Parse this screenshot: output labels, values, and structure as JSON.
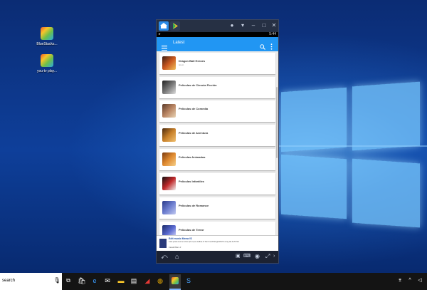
{
  "desktop": {
    "icons": [
      {
        "label": "BlueStacks..."
      },
      {
        "label": "you-tv play..."
      }
    ]
  },
  "bluestacks": {
    "status": {
      "time": "5:44"
    },
    "appbar": {
      "title": "Latest",
      "menu_icon": "menu-icon",
      "search_icon": "search-icon",
      "more_icon": "more-vert-icon"
    },
    "items": [
      {
        "title": "Dragon Ball Heroes",
        "subtitle": "latest"
      },
      {
        "title": "Películas de Ciencia Ficción",
        "subtitle": ""
      },
      {
        "title": "Películas de Comedia",
        "subtitle": ""
      },
      {
        "title": "Películas de Aventura",
        "subtitle": ""
      },
      {
        "title": "Películas Animadas",
        "subtitle": ""
      },
      {
        "title": "Películas Infantiles",
        "subtitle": ""
      },
      {
        "title": "Películas de Romance",
        "subtitle": ""
      },
      {
        "title": "Películas de Terror",
        "subtitle": ""
      }
    ],
    "ad": {
      "title": "Edit music Meow IS",
      "body": "Ciao phela stunne Voice (5 st Ipso ledbia Ai Sisi bra Wlutingl ERVIS a big ida ALTCSS",
      "footer": "Cassidi Bam Jr"
    }
  },
  "taskbar": {
    "search_text": "search"
  },
  "colors": {
    "accent": "#2196f3"
  }
}
